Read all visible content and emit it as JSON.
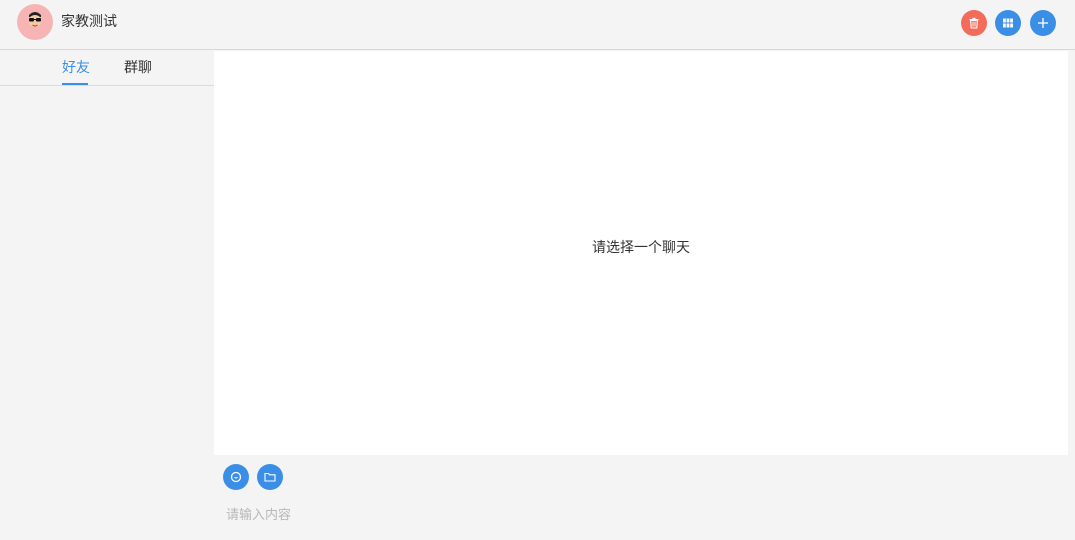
{
  "header": {
    "user_name": "家教测试",
    "avatar_icon": "cartoon-face-with-sunglasses",
    "buttons": [
      {
        "icon": "trash-icon",
        "color": "#f26b5b"
      },
      {
        "icon": "grid-icon",
        "color": "#3a8ee6"
      },
      {
        "icon": "plus-icon",
        "color": "#3a8ee6"
      }
    ]
  },
  "sidebar": {
    "tabs": [
      {
        "label": "好友",
        "active": true
      },
      {
        "label": "群聊",
        "active": false
      }
    ]
  },
  "chat": {
    "empty_message": "请选择一个聊天"
  },
  "composer": {
    "tools": [
      {
        "icon": "emoji-icon"
      },
      {
        "icon": "folder-icon"
      }
    ],
    "placeholder": "请输入内容",
    "value": ""
  },
  "colors": {
    "accent": "#3a8ee6",
    "danger": "#f26b5b",
    "avatar_bg": "#f7b4b4"
  }
}
